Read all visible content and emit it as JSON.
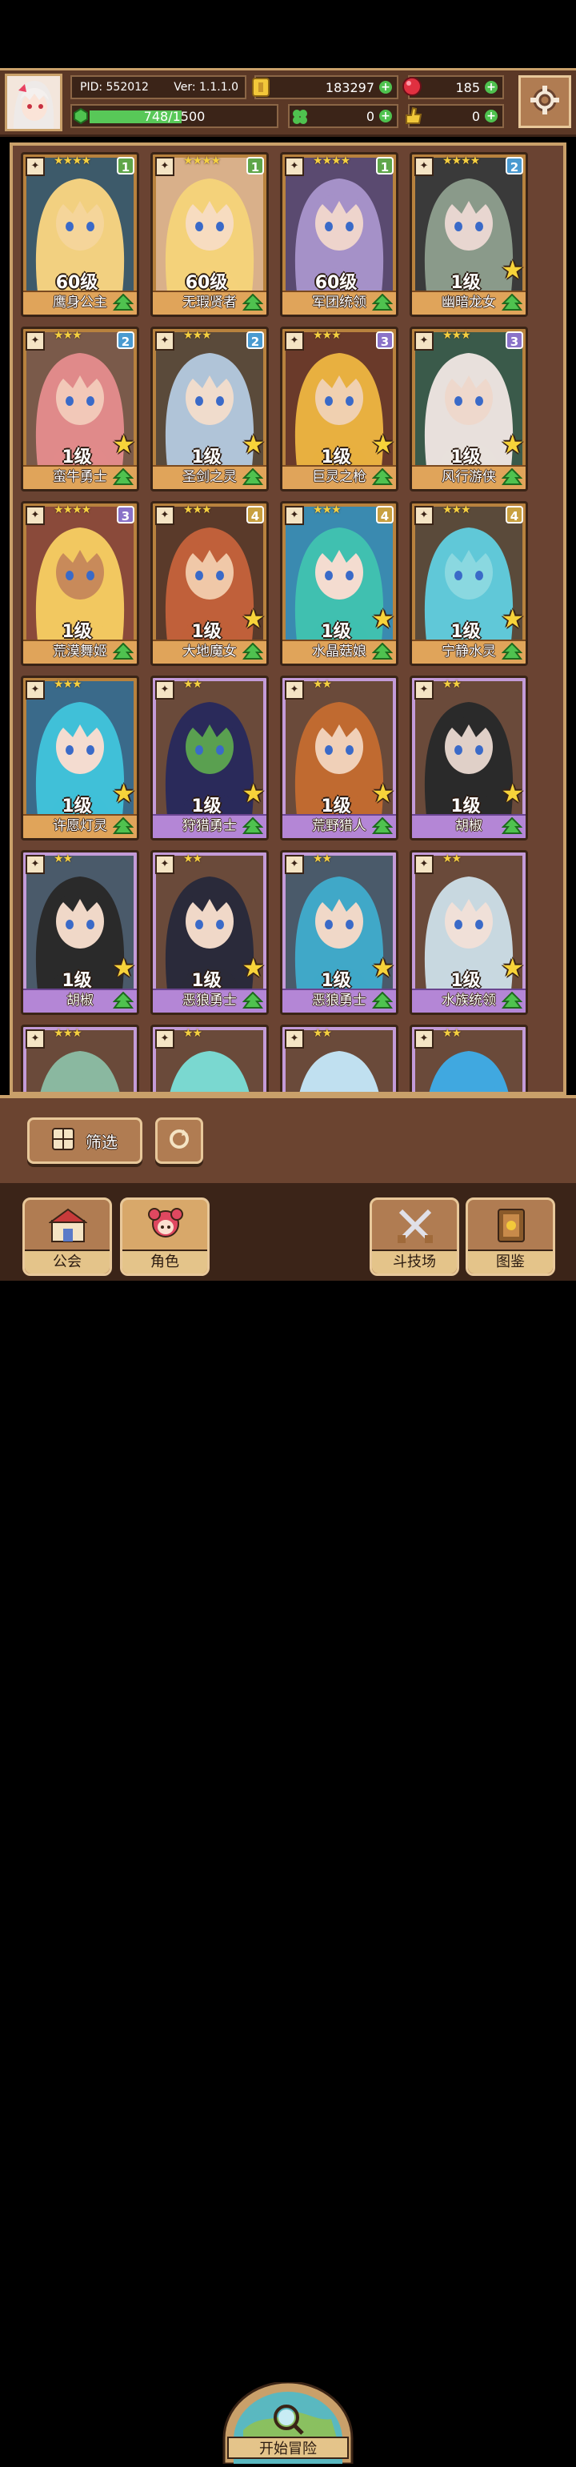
{
  "player": {
    "pid_label": "PID: 552012",
    "version_label": "Ver: 1.1.1.0",
    "exp_text": "748/1500",
    "exp_fraction": 0.4987,
    "gold": "183297",
    "gems": "185",
    "clover": "0",
    "thumbs": "0"
  },
  "cards": [
    {
      "name": "鹰身公主",
      "level": "60级",
      "stars": "★★★★",
      "badge": "1",
      "badge_color": "#5fa64a",
      "rarity": "gold",
      "skin": "#f5d59a",
      "hair": "#f2d080",
      "bg": "#3d5a6a",
      "show_star": false
    },
    {
      "name": "无瑕贤者",
      "level": "60级",
      "stars": "★★★★",
      "badge": "1",
      "badge_color": "#5fa64a",
      "rarity": "gold",
      "skin": "#f7dcc0",
      "hair": "#f4d27a",
      "bg": "#d9b08a",
      "show_star": false
    },
    {
      "name": "军团统领",
      "level": "60级",
      "stars": "★★★★",
      "badge": "1",
      "badge_color": "#5fa64a",
      "rarity": "gold",
      "skin": "#eed4cc",
      "hair": "#a591c8",
      "bg": "#5a4a70",
      "show_star": false
    },
    {
      "name": "幽暗龙女",
      "level": "1级",
      "stars": "★★★★",
      "badge": "2",
      "badge_color": "#4a9ad0",
      "rarity": "gold",
      "skin": "#e8d6d0",
      "hair": "#8a9a8a",
      "bg": "#3a3a3a",
      "show_star": true
    },
    {
      "name": "蛮牛勇士",
      "level": "1级",
      "stars": "★★★",
      "badge": "2",
      "badge_color": "#4a9ad0",
      "rarity": "gold",
      "skin": "#f2c8b8",
      "hair": "#e08a8a",
      "bg": "#7a5a4a",
      "show_star": true
    },
    {
      "name": "圣剑之灵",
      "level": "1级",
      "stars": "★★★",
      "badge": "2",
      "badge_color": "#4a9ad0",
      "rarity": "gold",
      "skin": "#f0dccc",
      "hair": "#b0c4d8",
      "bg": "#5a4a3a",
      "show_star": true
    },
    {
      "name": "巨灵之枪",
      "level": "1级",
      "stars": "★★★",
      "badge": "3",
      "badge_color": "#8a72c8",
      "rarity": "gold",
      "skin": "#f0d0b0",
      "hair": "#e8b040",
      "bg": "#6a3a2a",
      "show_star": true
    },
    {
      "name": "风行游侠",
      "level": "1级",
      "stars": "★★★",
      "badge": "3",
      "badge_color": "#8a72c8",
      "rarity": "gold",
      "skin": "#eed8cc",
      "hair": "#e8e0dc",
      "bg": "#3a5a4a",
      "show_star": true
    },
    {
      "name": "荒漠舞姬",
      "level": "1级",
      "stars": "★★★★",
      "badge": "3",
      "badge_color": "#8a72c8",
      "rarity": "gold",
      "skin": "#c88a5a",
      "hair": "#f2c860",
      "bg": "#8a4a3a",
      "show_star": false
    },
    {
      "name": "大地魔女",
      "level": "1级",
      "stars": "★★★",
      "badge": "4",
      "badge_color": "#c8a040",
      "rarity": "gold",
      "skin": "#f0c8a8",
      "hair": "#c0603a",
      "bg": "#5a3a2a",
      "show_star": true
    },
    {
      "name": "水晶菇娘",
      "level": "1级",
      "stars": "★★★",
      "badge": "4",
      "badge_color": "#c8a040",
      "rarity": "gold",
      "skin": "#f4dcd0",
      "hair": "#40c0b0",
      "bg": "#3a8ab0",
      "show_star": true
    },
    {
      "name": "宁静水灵",
      "level": "1级",
      "stars": "★★★",
      "badge": "4",
      "badge_color": "#c8a040",
      "rarity": "gold",
      "skin": "#8ad8e0",
      "hair": "#60c8d8",
      "bg": "#5a4a3a",
      "show_star": true
    },
    {
      "name": "许愿灯灵",
      "level": "1级",
      "stars": "★★★",
      "badge": "",
      "badge_color": "",
      "rarity": "gold",
      "skin": "#f4dcd0",
      "hair": "#40c0d8",
      "bg": "#3a6a8a",
      "show_star": true
    },
    {
      "name": "狩猎勇士",
      "level": "1级",
      "stars": "★★",
      "badge": "",
      "badge_color": "",
      "rarity": "purple",
      "skin": "#5aa050",
      "hair": "#2a2a5a",
      "bg": "#6a4a3a",
      "show_star": true
    },
    {
      "name": "荒野猎人",
      "level": "1级",
      "stars": "★★",
      "badge": "",
      "badge_color": "",
      "rarity": "purple",
      "skin": "#f0d0b8",
      "hair": "#c06a30",
      "bg": "#6a4a3a",
      "show_star": true
    },
    {
      "name": "胡椒",
      "level": "1级",
      "stars": "★★",
      "badge": "",
      "badge_color": "",
      "rarity": "purple",
      "skin": "#e0d0c8",
      "hair": "#2a2a2a",
      "bg": "#6a4a3a",
      "show_star": true
    },
    {
      "name": "胡椒",
      "level": "1级",
      "stars": "★★",
      "badge": "",
      "badge_color": "",
      "rarity": "purple",
      "skin": "#f0d8c8",
      "hair": "#2a2a2a",
      "bg": "#4a5a6a",
      "show_star": true
    },
    {
      "name": "恶狼勇士",
      "level": "1级",
      "stars": "★★",
      "badge": "",
      "badge_color": "",
      "rarity": "purple",
      "skin": "#f0d8c8",
      "hair": "#2a2a3a",
      "bg": "#6a4a3a",
      "show_star": true
    },
    {
      "name": "恶狼勇士",
      "level": "1级",
      "stars": "★★",
      "badge": "",
      "badge_color": "",
      "rarity": "purple",
      "skin": "#f0d8c8",
      "hair": "#40a8c8",
      "bg": "#4a5a6a",
      "show_star": true
    },
    {
      "name": "水族统领",
      "level": "1级",
      "stars": "★★",
      "badge": "",
      "badge_color": "",
      "rarity": "purple",
      "skin": "#f0e0d8",
      "hair": "#c8d8e0",
      "bg": "#6a4a3a",
      "show_star": true
    },
    {
      "name": "",
      "level": "",
      "stars": "★★★",
      "badge": "",
      "badge_color": "",
      "rarity": "purple",
      "skin": "#8ab8a0",
      "hair": "#8ab8a0",
      "bg": "#6a4a3a",
      "show_star": false
    },
    {
      "name": "",
      "level": "",
      "stars": "★★",
      "badge": "",
      "badge_color": "",
      "rarity": "purple",
      "skin": "#7ad8d0",
      "hair": "#7ad8d0",
      "bg": "#6a4a3a",
      "show_star": false
    },
    {
      "name": "",
      "level": "",
      "stars": "★★",
      "badge": "",
      "badge_color": "",
      "rarity": "purple",
      "skin": "#c0e0f0",
      "hair": "#c0e0f0",
      "bg": "#6a4a3a",
      "show_star": false
    },
    {
      "name": "",
      "level": "",
      "stars": "★★",
      "badge": "",
      "badge_color": "",
      "rarity": "purple",
      "skin": "#40a8e0",
      "hair": "#40a8e0",
      "bg": "#6a4a3a",
      "show_star": false
    }
  ],
  "filter": {
    "label": "筛选"
  },
  "nav": {
    "guild": "公会",
    "character": "角色",
    "adventure": "开始冒险",
    "arena": "斗技场",
    "codex": "图鉴"
  }
}
